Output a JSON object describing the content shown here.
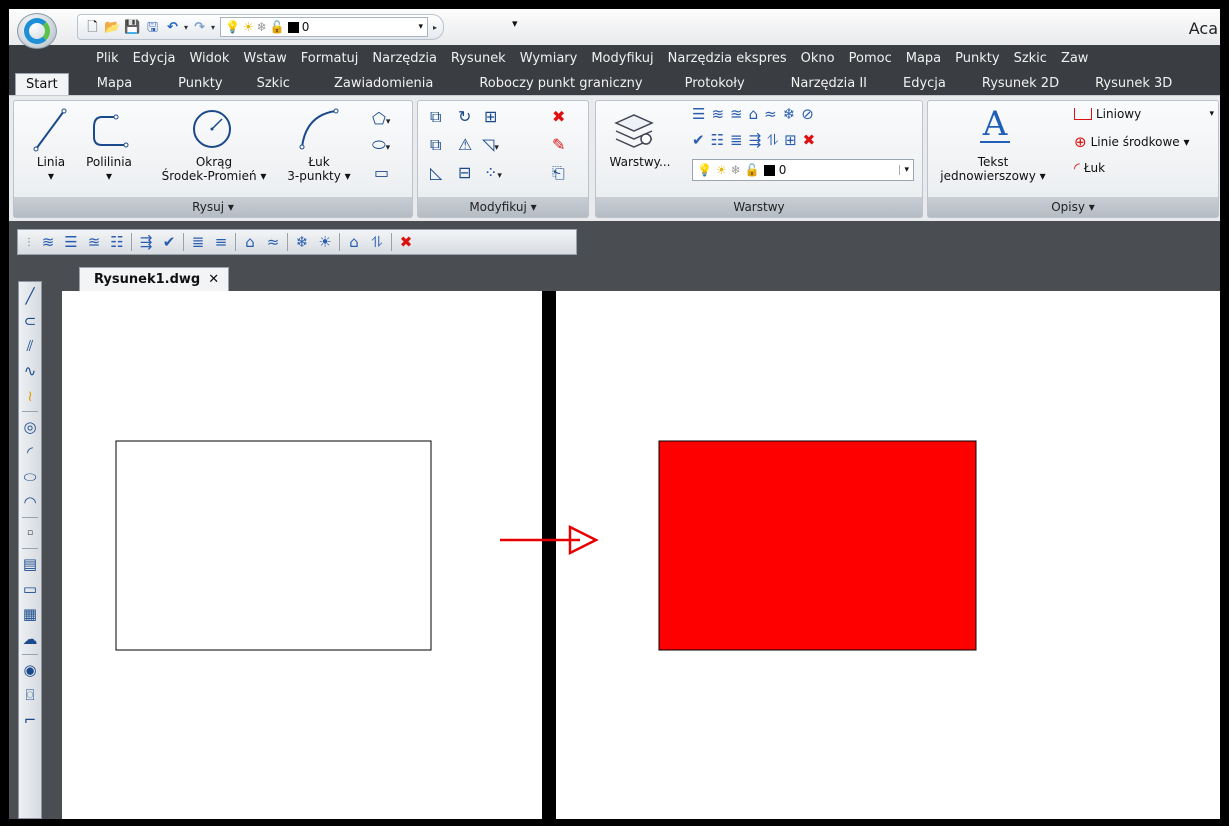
{
  "app": {
    "title_partial": "Aca",
    "qat_layer_value": "0",
    "qat_more": "❒"
  },
  "menu": [
    "Plik",
    "Edycja",
    "Widok",
    "Wstaw",
    "Formatuj",
    "Narzędzia",
    "Rysunek",
    "Wymiary",
    "Modyfikuj",
    "Narzędzia ekspres",
    "Okno",
    "Pomoc",
    "Mapa",
    "Punkty",
    "Szkic",
    "Zaw"
  ],
  "ribbon_tabs": [
    "Start",
    "Mapa",
    "Punkty",
    "Szkic",
    "Zawiadomienia",
    "Roboczy punkt graniczny",
    "Protokoły",
    "Narzędzia II",
    "Edycja",
    "Rysunek 2D",
    "Rysunek 3D"
  ],
  "panels": {
    "rysuj": {
      "title": "Rysuj ▾",
      "linia": "Linia",
      "polilinia": "Polilinia",
      "okrag_1": "Okrąg",
      "okrag_2": "Środek-Promień ▾",
      "luk_1": "Łuk",
      "luk_2": "3-punkty ▾",
      "dd": "▾"
    },
    "modyfikuj": {
      "title": "Modyfikuj ▾"
    },
    "warstwy": {
      "title": "Warstwy",
      "button": "Warstwy...",
      "layer_value": "0"
    },
    "opisy": {
      "title": "Opisy ▾",
      "tekst_1": "Tekst",
      "tekst_2": "jednowierszowy ▾",
      "liniowy": "Liniowy",
      "linie_srodkowe": "Linie środkowe ▾",
      "luk": "Łuk"
    }
  },
  "document": {
    "tab": "Rysunek1.dwg",
    "close": "✕"
  },
  "drawing": {
    "outline_fill": "#ffffff",
    "target_fill": "#ff0000",
    "arrow_color": "#e60000",
    "divider_color": "#000000"
  }
}
